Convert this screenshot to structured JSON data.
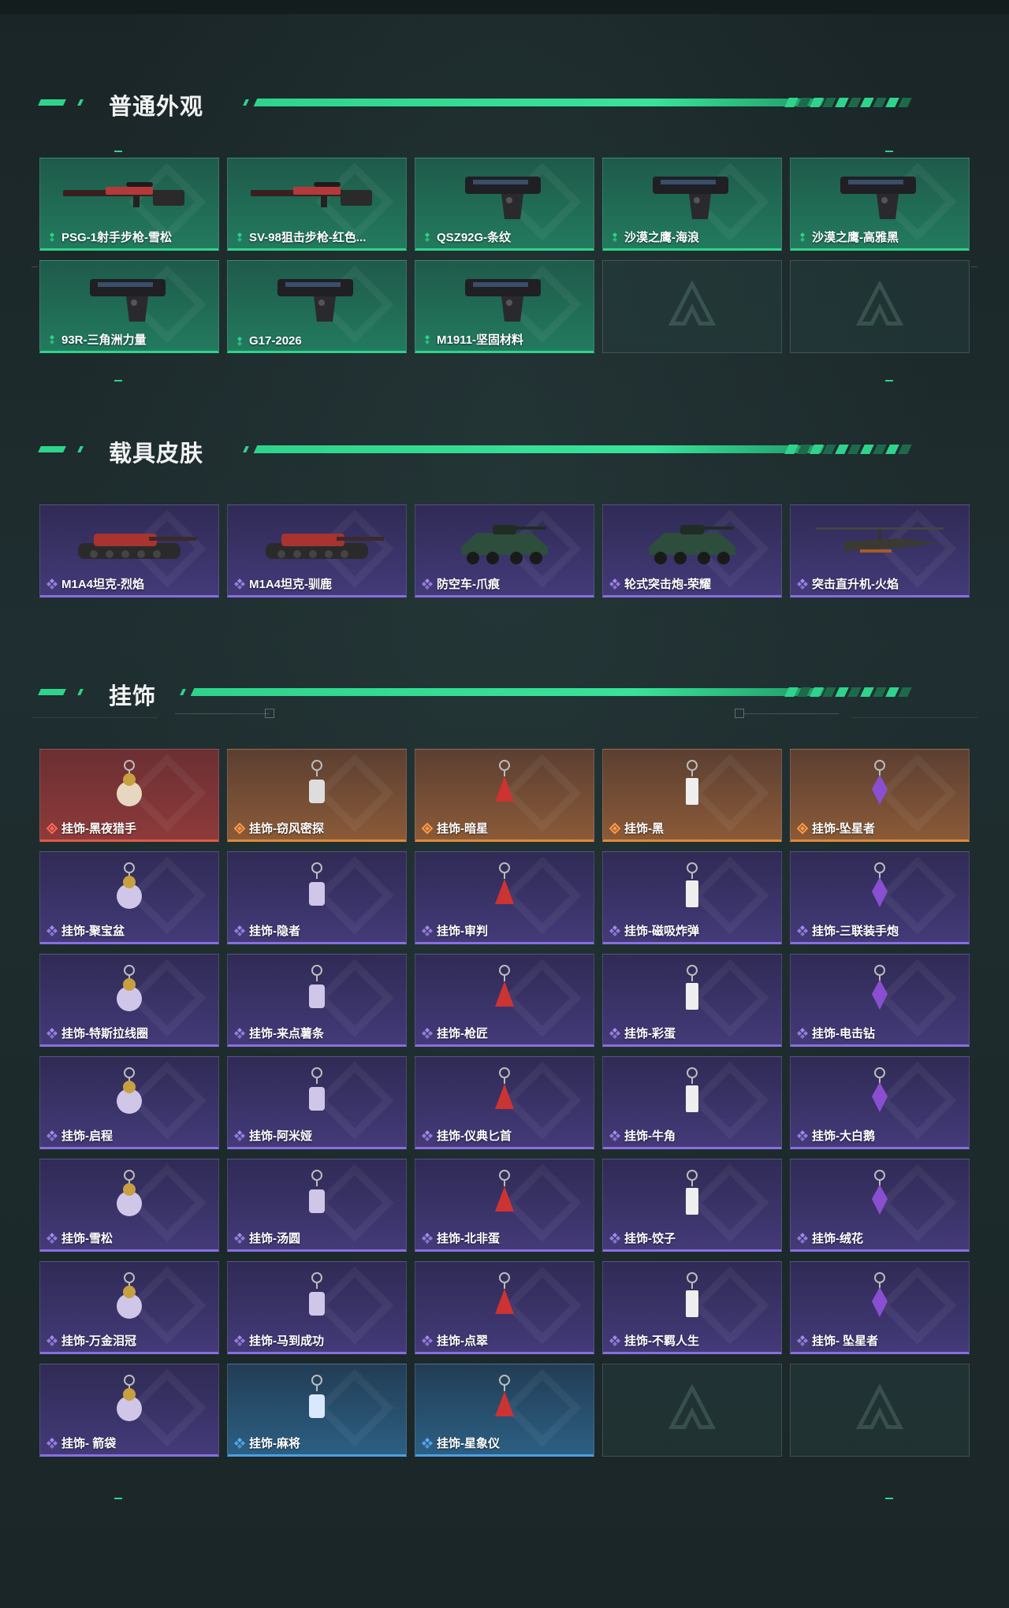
{
  "colors": {
    "accent": "#2fd48c",
    "green_card": "#227a5e",
    "purple_card": "#433a78",
    "red_card": "#8e3a3a",
    "orange_card": "#8a5a38",
    "blue_card": "#2c5f83"
  },
  "sections": [
    {
      "title": "普通外观"
    },
    {
      "title": "载具皮肤"
    },
    {
      "title": "挂饰"
    }
  ],
  "weapons": [
    {
      "label": "PSG-1射手步枪-雪松",
      "rarity": "green",
      "icon": "sniper-rifle-icon"
    },
    {
      "label": "SV-98狙击步枪-红色...",
      "rarity": "green",
      "icon": "sniper-rifle-icon"
    },
    {
      "label": "QSZ92G-条纹",
      "rarity": "green",
      "icon": "pistol-icon"
    },
    {
      "label": "沙漠之鹰-海浪",
      "rarity": "green",
      "icon": "pistol-icon"
    },
    {
      "label": "沙漠之鹰-高雅黑",
      "rarity": "green",
      "icon": "pistol-icon"
    },
    {
      "label": "93R-三角洲力量",
      "rarity": "green",
      "icon": "pistol-icon"
    },
    {
      "label": "G17-2026",
      "rarity": "green",
      "icon": "pistol-icon"
    },
    {
      "label": "M1911-坚固材料",
      "rarity": "green",
      "icon": "pistol-icon"
    }
  ],
  "vehicles": [
    {
      "label": "M1A4坦克-烈焰",
      "rarity": "purple",
      "icon": "tank-icon"
    },
    {
      "label": "M1A4坦克-驯鹿",
      "rarity": "purple",
      "icon": "tank-icon"
    },
    {
      "label": "防空车-爪痕",
      "rarity": "purple",
      "icon": "armored-vehicle-icon"
    },
    {
      "label": "轮式突击炮-荣耀",
      "rarity": "purple",
      "icon": "armored-vehicle-icon"
    },
    {
      "label": "突击直升机-火焰",
      "rarity": "purple",
      "icon": "helicopter-icon"
    }
  ],
  "charms": [
    {
      "label": "挂饰-黑夜猎手",
      "rarity": "red"
    },
    {
      "label": "挂饰-窃风密探",
      "rarity": "orange"
    },
    {
      "label": "挂饰-暗星",
      "rarity": "orange"
    },
    {
      "label": "挂饰-黑",
      "rarity": "orange"
    },
    {
      "label": "挂饰-坠星者",
      "rarity": "orange"
    },
    {
      "label": "挂饰-聚宝盆",
      "rarity": "purple"
    },
    {
      "label": "挂饰-隐者",
      "rarity": "purple"
    },
    {
      "label": "挂饰-审判",
      "rarity": "purple"
    },
    {
      "label": "挂饰-磁吸炸弹",
      "rarity": "purple"
    },
    {
      "label": "挂饰-三联装手炮",
      "rarity": "purple"
    },
    {
      "label": "挂饰-特斯拉线圈",
      "rarity": "purple"
    },
    {
      "label": "挂饰-来点薯条",
      "rarity": "purple"
    },
    {
      "label": "挂饰-枪匠",
      "rarity": "purple"
    },
    {
      "label": "挂饰-彩蛋",
      "rarity": "purple"
    },
    {
      "label": "挂饰-电击钻",
      "rarity": "purple"
    },
    {
      "label": "挂饰-启程",
      "rarity": "purple"
    },
    {
      "label": "挂饰-阿米娅",
      "rarity": "purple"
    },
    {
      "label": "挂饰-仪典匕首",
      "rarity": "purple"
    },
    {
      "label": "挂饰-牛角",
      "rarity": "purple"
    },
    {
      "label": "挂饰-大白鹅",
      "rarity": "purple"
    },
    {
      "label": "挂饰-雪松",
      "rarity": "purple"
    },
    {
      "label": "挂饰-汤圆",
      "rarity": "purple"
    },
    {
      "label": "挂饰-北非蛋",
      "rarity": "purple"
    },
    {
      "label": "挂饰-饺子",
      "rarity": "purple"
    },
    {
      "label": "挂饰-绒花",
      "rarity": "purple"
    },
    {
      "label": "挂饰-万金泪冠",
      "rarity": "purple"
    },
    {
      "label": "挂饰-马到成功",
      "rarity": "purple"
    },
    {
      "label": "挂饰-点翠",
      "rarity": "purple"
    },
    {
      "label": "挂饰-不羁人生",
      "rarity": "purple"
    },
    {
      "label": "挂饰- 坠星者",
      "rarity": "purple"
    },
    {
      "label": "挂饰- 箭袋",
      "rarity": "purple"
    },
    {
      "label": "挂饰-麻将",
      "rarity": "blue"
    },
    {
      "label": "挂饰-星象仪",
      "rarity": "blue"
    }
  ],
  "empty_slots": {
    "weapons": 2,
    "charms": 2
  }
}
